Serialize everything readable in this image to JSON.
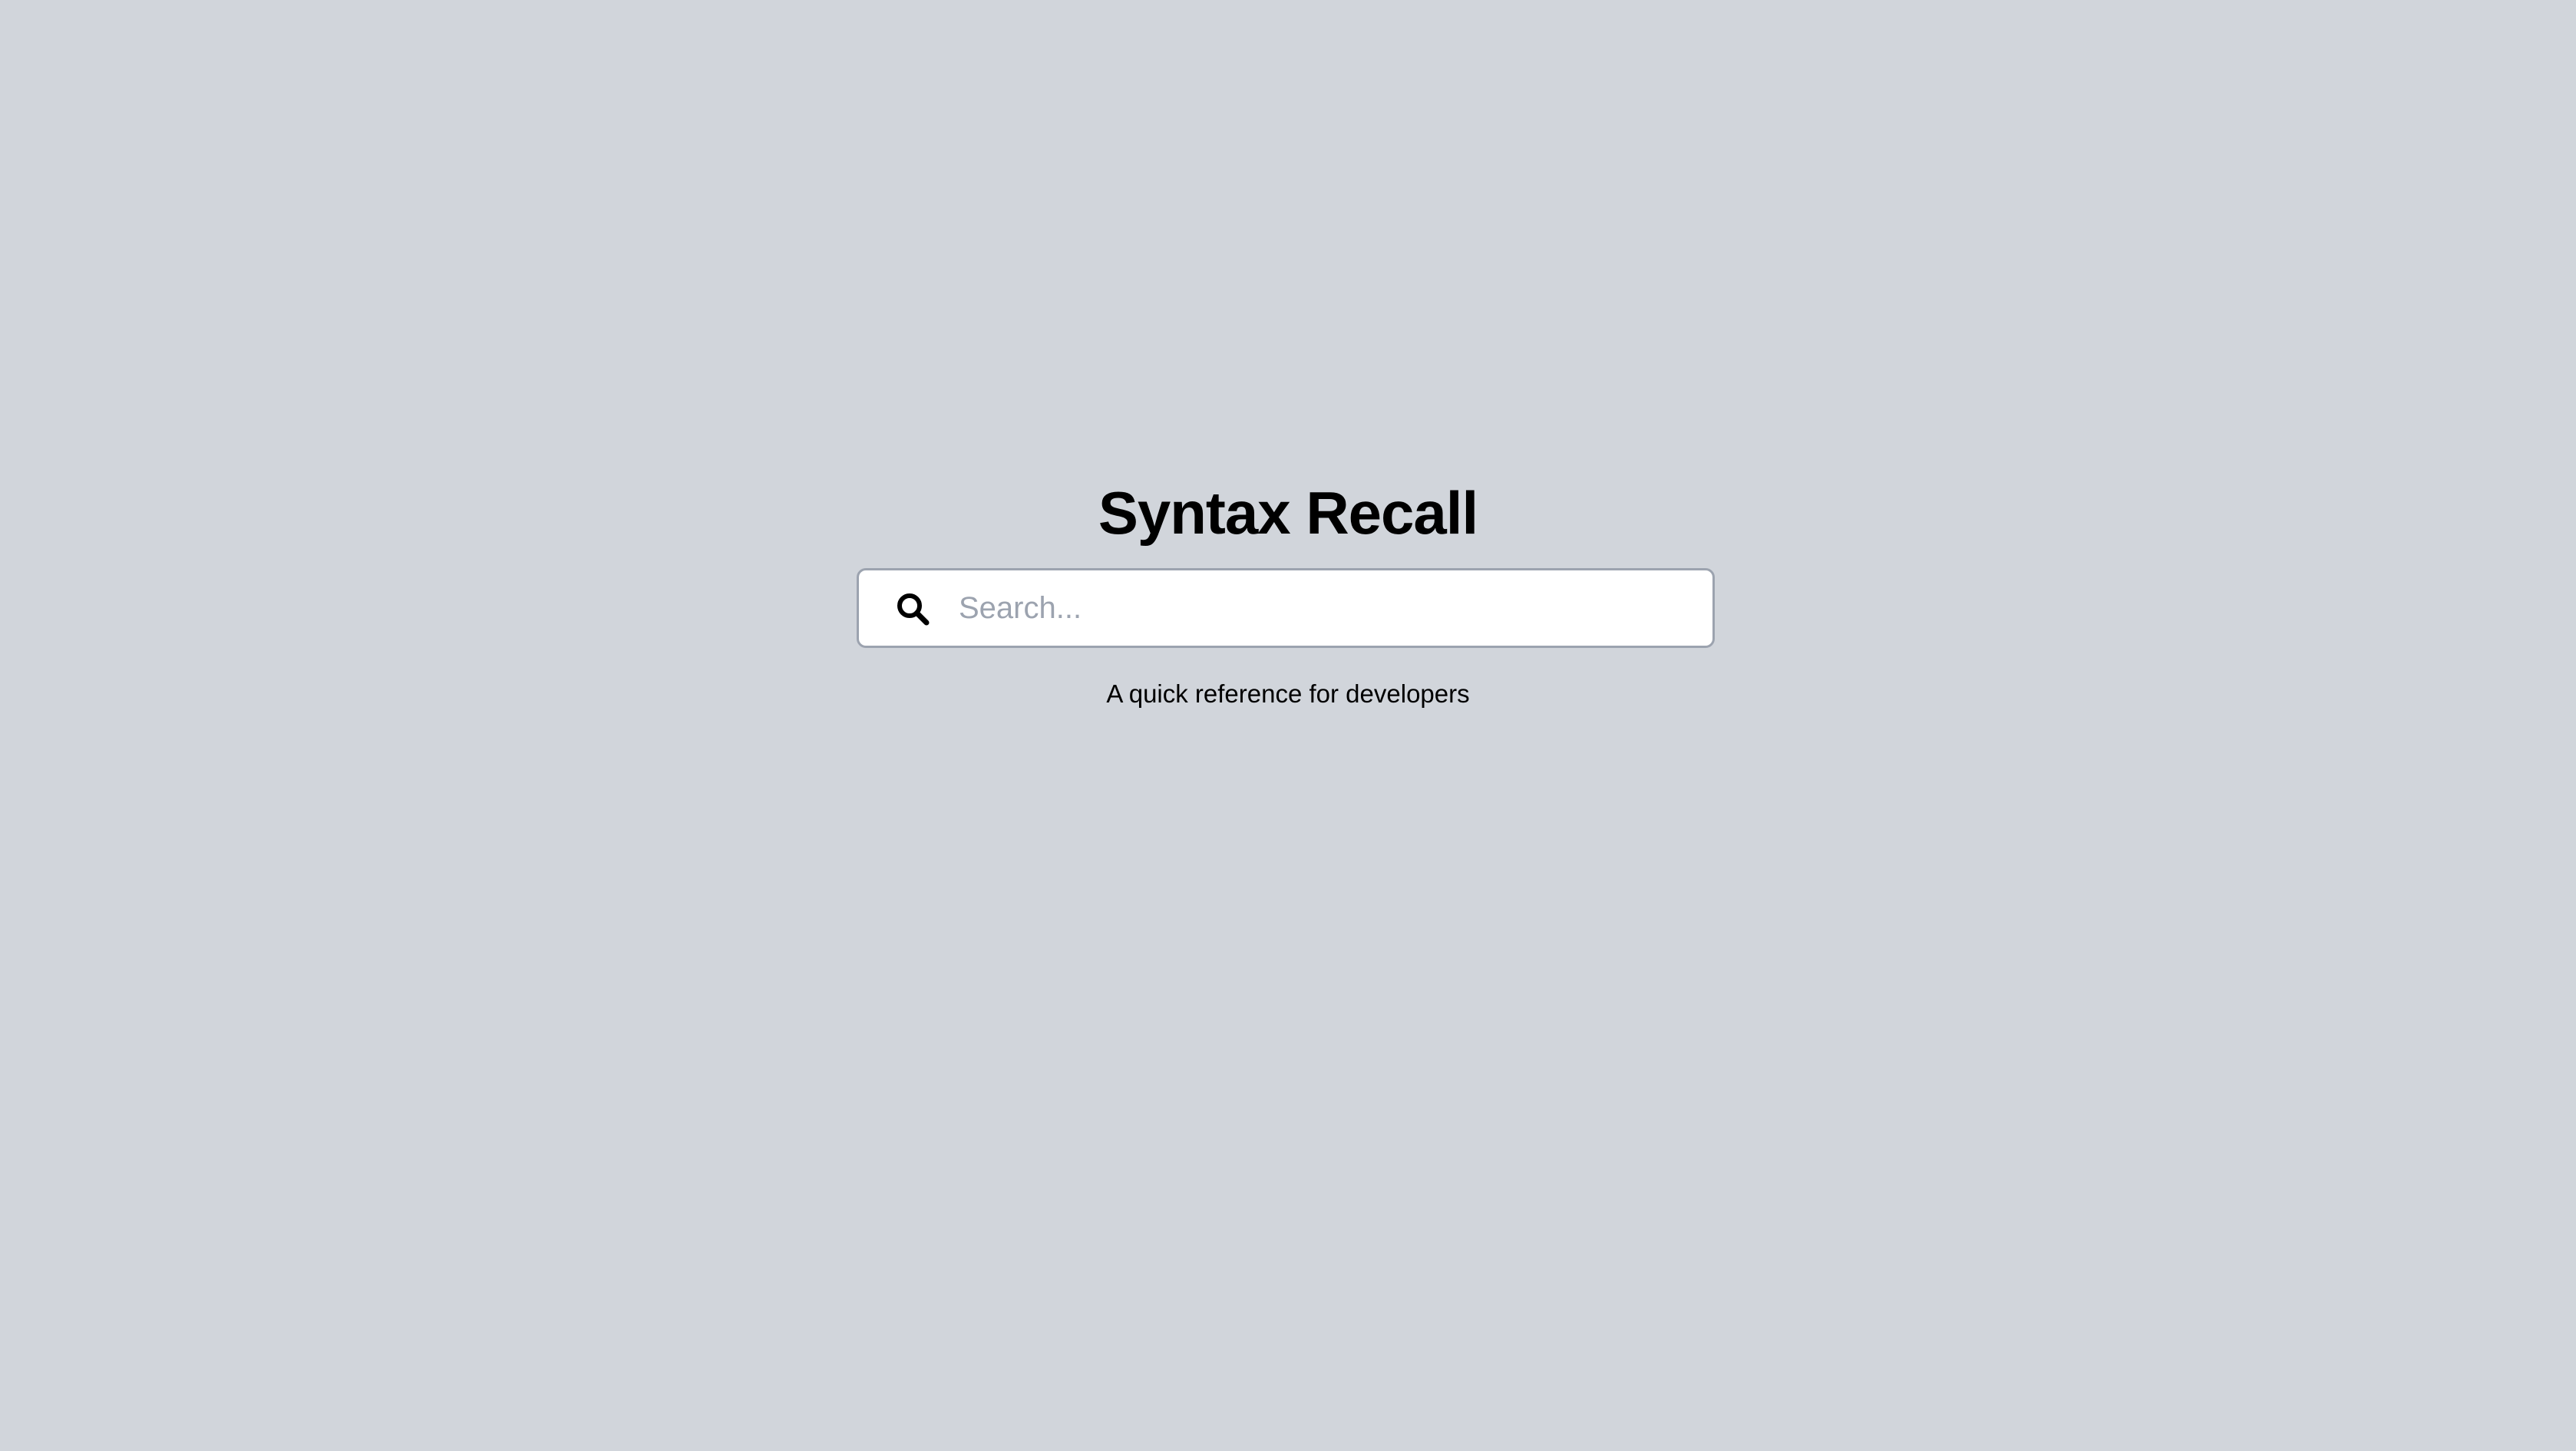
{
  "app": {
    "title": "Syntax Recall",
    "tagline": "A quick reference for developers"
  },
  "search": {
    "placeholder": "Search...",
    "value": "",
    "icon": "search-icon"
  },
  "colors": {
    "background": "#d1d5db",
    "input_background": "#ffffff",
    "input_border": "#9ca3af",
    "placeholder": "#9ca3af",
    "text": "#000000"
  }
}
